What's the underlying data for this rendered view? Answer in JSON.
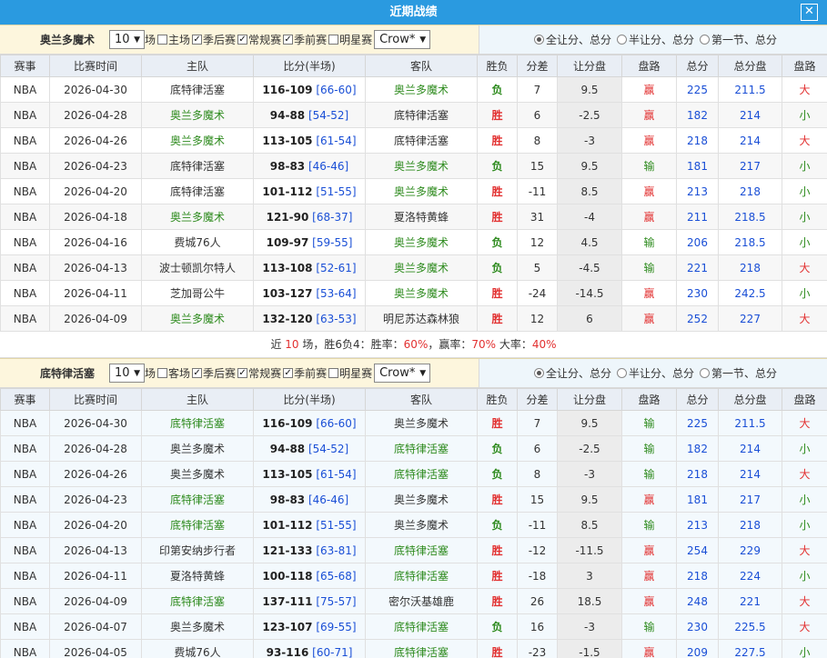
{
  "title": "近期战绩",
  "colors": {
    "header": "#2a9ae0",
    "win": "#e23030",
    "loss": "#2e8b1e",
    "blue": "#1a4fd6"
  },
  "icons": {
    "close": "close-icon"
  },
  "headers": [
    "赛事",
    "比赛时间",
    "主队",
    "比分(半场)",
    "客队",
    "胜负",
    "分差",
    "让分盘",
    "盘路",
    "总分",
    "总分盘",
    "盘路"
  ],
  "sections": [
    {
      "team": "奥兰多魔术",
      "count": "10",
      "count_unit": "场",
      "checks": [
        {
          "label": "主场",
          "on": false
        },
        {
          "label": "季后赛",
          "on": true
        },
        {
          "label": "常规赛",
          "on": true
        },
        {
          "label": "季前赛",
          "on": true
        },
        {
          "label": "明星赛",
          "on": false
        }
      ],
      "company": "Crow*",
      "radios": [
        {
          "label": "全让分、总分",
          "on": true
        },
        {
          "label": "半让分、总分",
          "on": false
        },
        {
          "label": "第一节、总分",
          "on": false
        }
      ],
      "rows": [
        [
          "NBA",
          "2026-04-30",
          "底特律活塞",
          "116-109",
          "[66-60]",
          "奥兰多魔术",
          "负",
          "7",
          "9.5",
          "赢",
          "225",
          "211.5",
          "大"
        ],
        [
          "NBA",
          "2026-04-28",
          "奥兰多魔术",
          "94-88",
          "[54-52]",
          "底特律活塞",
          "胜",
          "6",
          "-2.5",
          "赢",
          "182",
          "214",
          "小"
        ],
        [
          "NBA",
          "2026-04-26",
          "奥兰多魔术",
          "113-105",
          "[61-54]",
          "底特律活塞",
          "胜",
          "8",
          "-3",
          "赢",
          "218",
          "214",
          "大"
        ],
        [
          "NBA",
          "2026-04-23",
          "底特律活塞",
          "98-83",
          "[46-46]",
          "奥兰多魔术",
          "负",
          "15",
          "9.5",
          "输",
          "181",
          "217",
          "小"
        ],
        [
          "NBA",
          "2026-04-20",
          "底特律活塞",
          "101-112",
          "[51-55]",
          "奥兰多魔术",
          "胜",
          "-11",
          "8.5",
          "赢",
          "213",
          "218",
          "小"
        ],
        [
          "NBA",
          "2026-04-18",
          "奥兰多魔术",
          "121-90",
          "[68-37]",
          "夏洛特黄蜂",
          "胜",
          "31",
          "-4",
          "赢",
          "211",
          "218.5",
          "小"
        ],
        [
          "NBA",
          "2026-04-16",
          "费城76人",
          "109-97",
          "[59-55]",
          "奥兰多魔术",
          "负",
          "12",
          "4.5",
          "输",
          "206",
          "218.5",
          "小"
        ],
        [
          "NBA",
          "2026-04-13",
          "波士顿凯尔特人",
          "113-108",
          "[52-61]",
          "奥兰多魔术",
          "负",
          "5",
          "-4.5",
          "输",
          "221",
          "218",
          "大"
        ],
        [
          "NBA",
          "2026-04-11",
          "芝加哥公牛",
          "103-127",
          "[53-64]",
          "奥兰多魔术",
          "胜",
          "-24",
          "-14.5",
          "赢",
          "230",
          "242.5",
          "小"
        ],
        [
          "NBA",
          "2026-04-09",
          "奥兰多魔术",
          "132-120",
          "[63-53]",
          "明尼苏达森林狼",
          "胜",
          "12",
          "6",
          "赢",
          "252",
          "227",
          "大"
        ]
      ],
      "summary": {
        "pre": "近 ",
        "n": "10",
        "mid": " 场，胜6负4：胜率：",
        "win": "60%",
        "sep1": "，赢率：",
        "cover": "70%",
        "sep2": " 大率：",
        "big": "40%"
      }
    },
    {
      "team": "底特律活塞",
      "count": "10",
      "count_unit": "场",
      "checks": [
        {
          "label": "客场",
          "on": false
        },
        {
          "label": "季后赛",
          "on": true
        },
        {
          "label": "常规赛",
          "on": true
        },
        {
          "label": "季前赛",
          "on": true
        },
        {
          "label": "明星赛",
          "on": false
        }
      ],
      "company": "Crow*",
      "radios": [
        {
          "label": "全让分、总分",
          "on": true
        },
        {
          "label": "半让分、总分",
          "on": false
        },
        {
          "label": "第一节、总分",
          "on": false
        }
      ],
      "rows": [
        [
          "NBA",
          "2026-04-30",
          "底特律活塞",
          "116-109",
          "[66-60]",
          "奥兰多魔术",
          "胜",
          "7",
          "9.5",
          "输",
          "225",
          "211.5",
          "大"
        ],
        [
          "NBA",
          "2026-04-28",
          "奥兰多魔术",
          "94-88",
          "[54-52]",
          "底特律活塞",
          "负",
          "6",
          "-2.5",
          "输",
          "182",
          "214",
          "小"
        ],
        [
          "NBA",
          "2026-04-26",
          "奥兰多魔术",
          "113-105",
          "[61-54]",
          "底特律活塞",
          "负",
          "8",
          "-3",
          "输",
          "218",
          "214",
          "大"
        ],
        [
          "NBA",
          "2026-04-23",
          "底特律活塞",
          "98-83",
          "[46-46]",
          "奥兰多魔术",
          "胜",
          "15",
          "9.5",
          "赢",
          "181",
          "217",
          "小"
        ],
        [
          "NBA",
          "2026-04-20",
          "底特律活塞",
          "101-112",
          "[51-55]",
          "奥兰多魔术",
          "负",
          "-11",
          "8.5",
          "输",
          "213",
          "218",
          "小"
        ],
        [
          "NBA",
          "2026-04-13",
          "印第安纳步行者",
          "121-133",
          "[63-81]",
          "底特律活塞",
          "胜",
          "-12",
          "-11.5",
          "赢",
          "254",
          "229",
          "大"
        ],
        [
          "NBA",
          "2026-04-11",
          "夏洛特黄蜂",
          "100-118",
          "[65-68]",
          "底特律活塞",
          "胜",
          "-18",
          "3",
          "赢",
          "218",
          "224",
          "小"
        ],
        [
          "NBA",
          "2026-04-09",
          "底特律活塞",
          "137-111",
          "[75-57]",
          "密尔沃基雄鹿",
          "胜",
          "26",
          "18.5",
          "赢",
          "248",
          "221",
          "大"
        ],
        [
          "NBA",
          "2026-04-07",
          "奥兰多魔术",
          "123-107",
          "[69-55]",
          "底特律活塞",
          "负",
          "16",
          "-3",
          "输",
          "230",
          "225.5",
          "大"
        ],
        [
          "NBA",
          "2026-04-05",
          "费城76人",
          "93-116",
          "[60-71]",
          "底特律活塞",
          "胜",
          "-23",
          "-1.5",
          "赢",
          "209",
          "227.5",
          "小"
        ]
      ]
    }
  ]
}
